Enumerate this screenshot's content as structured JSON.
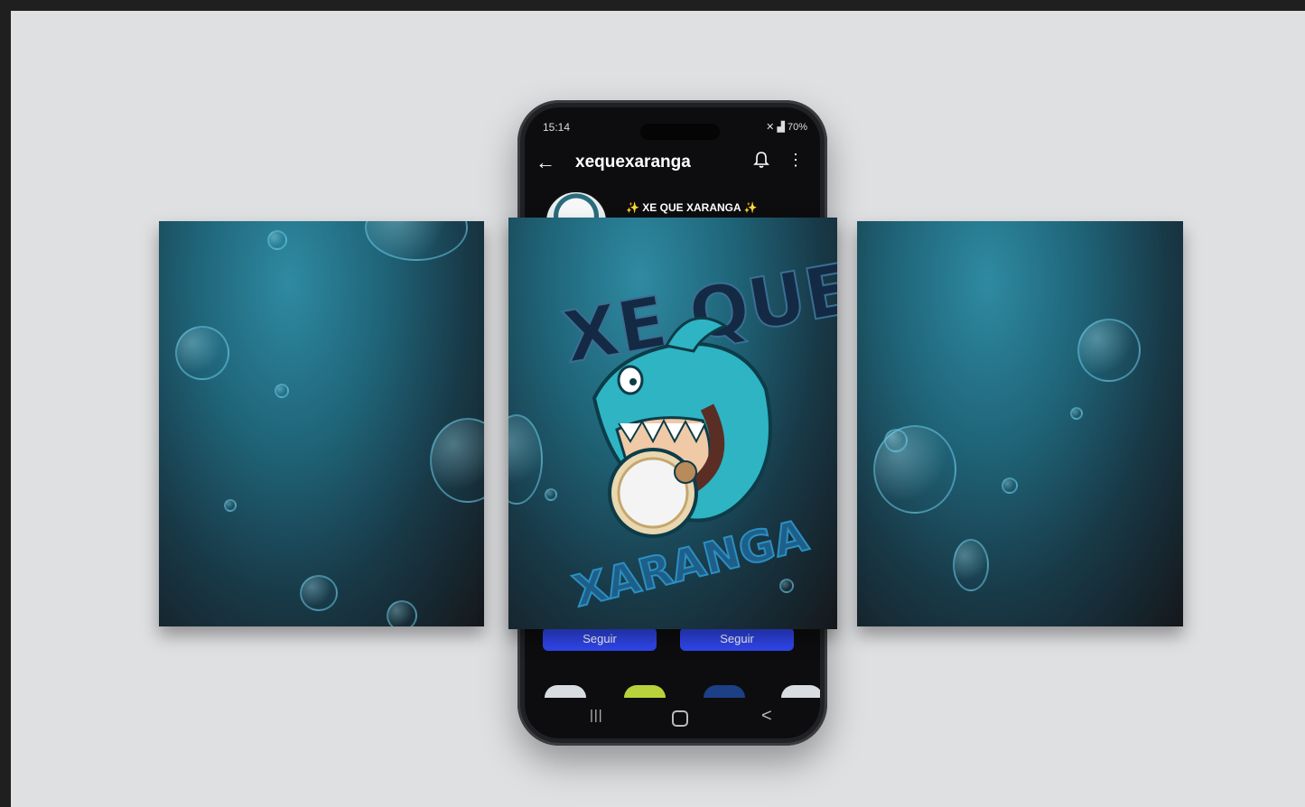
{
  "phone": {
    "status": {
      "time": "15:14",
      "battery": "70%"
    },
    "appbar": {
      "account_name": "xequexaranga",
      "back_icon": "arrow-left-icon",
      "bell_icon": "bell-icon",
      "more_icon": "more-vert-icon"
    },
    "profile": {
      "bio": "XE QUE XARANGA"
    },
    "buttons": {
      "follow_1": "Seguir",
      "follow_2": "Seguir"
    },
    "nav": {
      "recent": "|||",
      "back": "<"
    }
  },
  "artwork": {
    "top_text": "XE QUE",
    "bottom_text": "XARANGA"
  },
  "colors": {
    "accent": "#2f45e8",
    "ocean": "#1f6377",
    "shark": "#2fb4c4"
  }
}
